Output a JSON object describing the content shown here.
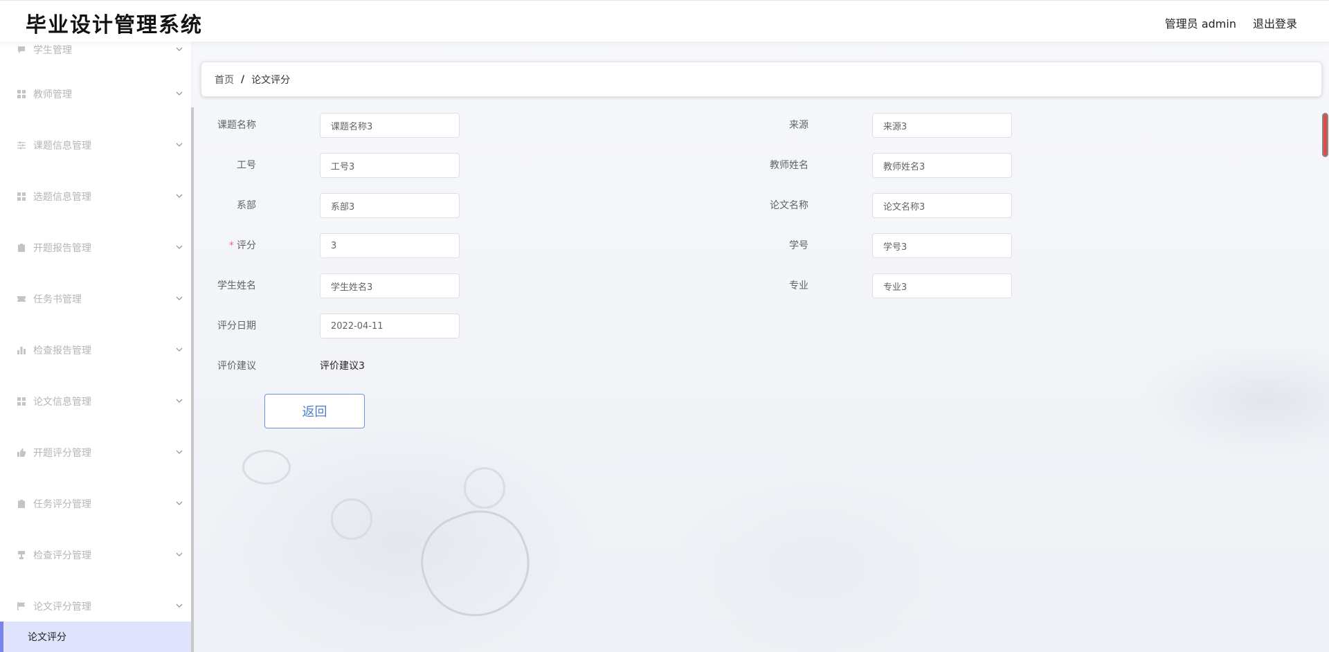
{
  "header": {
    "app_title": "毕业设计管理系统",
    "user_label": "管理员 admin",
    "logout_label": "退出登录"
  },
  "sidebar": {
    "items": [
      {
        "label": "学生管理",
        "icon": "message-icon"
      },
      {
        "label": "教师管理",
        "icon": "grid-icon"
      },
      {
        "label": "课题信息管理",
        "icon": "sliders-icon"
      },
      {
        "label": "选题信息管理",
        "icon": "grid-icon"
      },
      {
        "label": "开题报告管理",
        "icon": "clipboard-icon"
      },
      {
        "label": "任务书管理",
        "icon": "ticket-icon"
      },
      {
        "label": "检查报告管理",
        "icon": "bar-chart-icon"
      },
      {
        "label": "论文信息管理",
        "icon": "grid-icon"
      },
      {
        "label": "开题评分管理",
        "icon": "thumb-up-icon"
      },
      {
        "label": "任务评分管理",
        "icon": "clipboard-icon"
      },
      {
        "label": "检查评分管理",
        "icon": "trophy-icon"
      },
      {
        "label": "论文评分管理",
        "icon": "flag-icon"
      }
    ],
    "active_sub_item": "论文评分"
  },
  "breadcrumb": {
    "home": "首页",
    "separator": "/",
    "current": "论文评分"
  },
  "form": {
    "course_name": {
      "label": "课题名称",
      "value": "课题名称3"
    },
    "source": {
      "label": "来源",
      "value": "来源3"
    },
    "staff_no": {
      "label": "工号",
      "value": "工号3"
    },
    "teacher_name": {
      "label": "教师姓名",
      "value": "教师姓名3"
    },
    "department": {
      "label": "系部",
      "value": "系部3"
    },
    "thesis_name": {
      "label": "论文名称",
      "value": "论文名称3"
    },
    "score": {
      "label": "评分",
      "required_mark": "*",
      "value": "3"
    },
    "student_no": {
      "label": "学号",
      "value": "学号3"
    },
    "student_name": {
      "label": "学生姓名",
      "value": "学生姓名3"
    },
    "major": {
      "label": "专业",
      "value": "专业3"
    },
    "score_date": {
      "label": "评分日期",
      "value": "2022-04-11"
    },
    "suggestion": {
      "label": "评价建议",
      "value": "评价建议3"
    },
    "back_button": "返回"
  },
  "colors": {
    "accent": "#7a83ee",
    "active_bg": "#dfe3fb",
    "button_text": "#4f7fd0",
    "required": "#f56c6c"
  }
}
